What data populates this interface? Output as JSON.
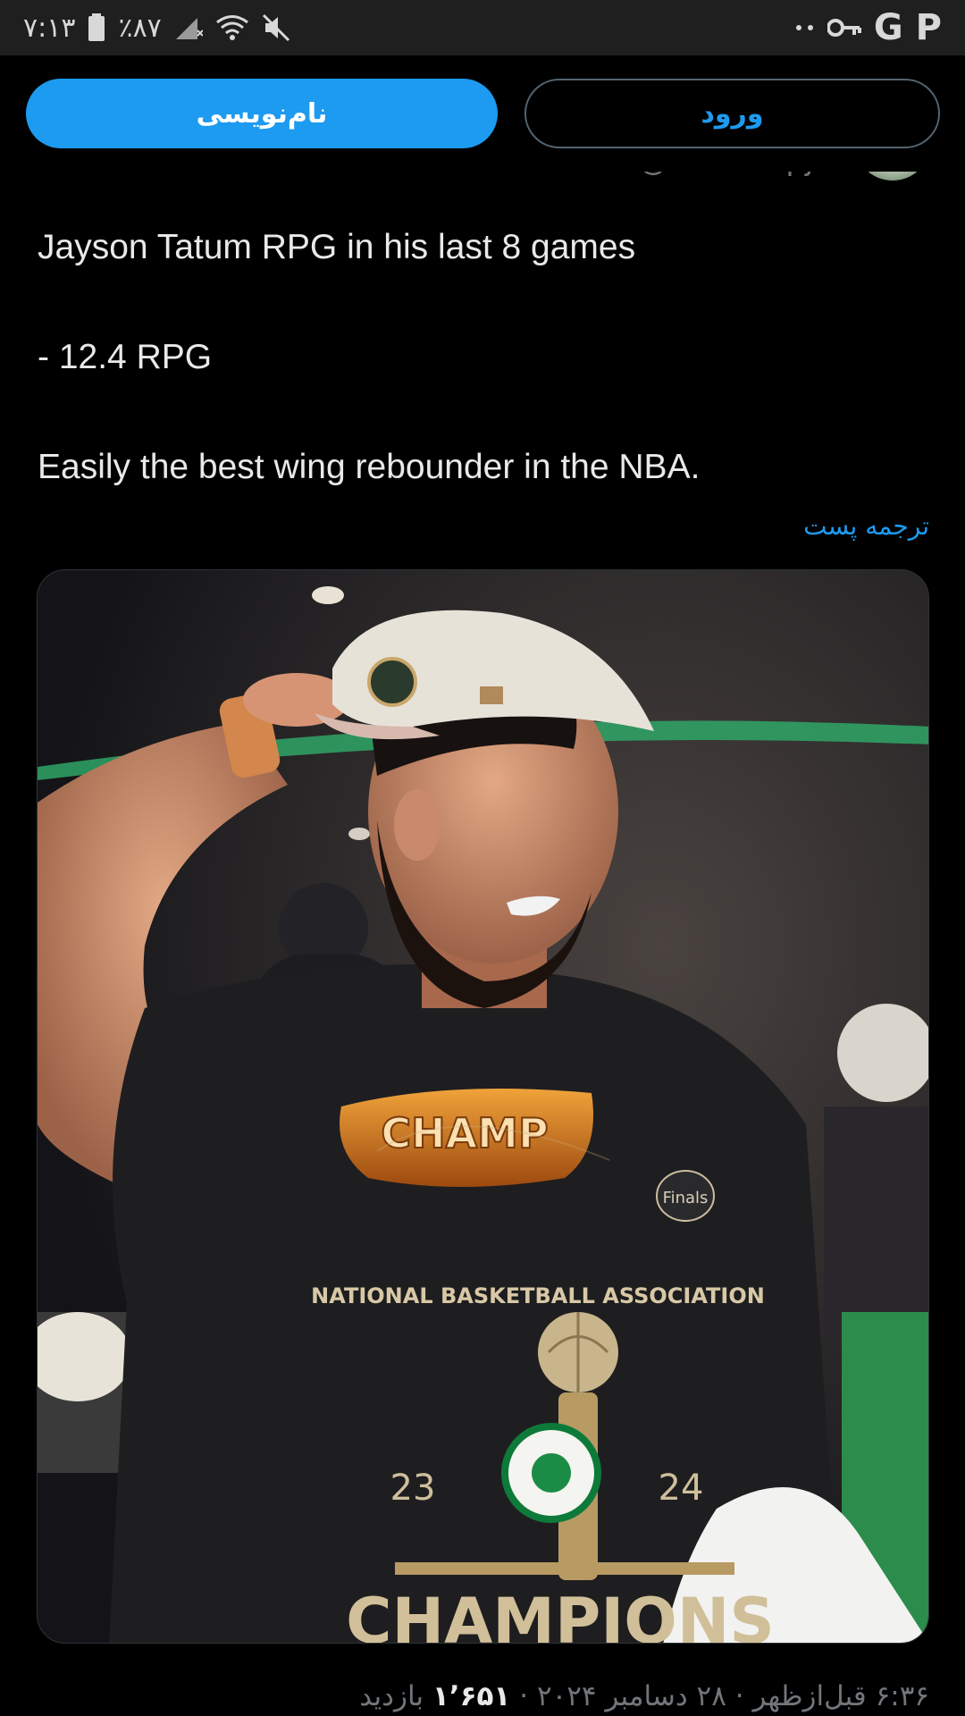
{
  "status_bar": {
    "time": "۷:۱۳",
    "battery": "٪۸۷",
    "icons_left": [
      "battery-icon",
      "signal-icon",
      "wifi-icon",
      "mute-icon"
    ],
    "icons_right": [
      "dots-icon",
      "key-icon",
      "google-icon",
      "p-app-icon"
    ],
    "google_letter": "G",
    "p_letter": "P"
  },
  "header": {
    "signup_label": "نام‌نویسی",
    "login_label": "ورود"
  },
  "author": {
    "handle": "@lockedupjb"
  },
  "tweet": {
    "line1": "Jayson Tatum RPG in his last 8 games",
    "line2": "- 12.4 RPG",
    "line3": "Easily the best wing rebounder in the NBA.",
    "translate_label": "ترجمه پست"
  },
  "media": {
    "goggles_text": "CHAMP",
    "shirt_text": "NATIONAL BASKETBALL ASSOCIATION",
    "bottom_text": "CHAMPIONS",
    "year_left": "23",
    "year_right": "24",
    "badge_text": "Finals"
  },
  "meta": {
    "time": "۶:۳۶ قبل‌ازظهر",
    "date": "۲۸ دسامبر ۲۰۲۴",
    "views_count": "۱٬۶۵۱",
    "views_label": "بازدید",
    "separator": "·"
  },
  "colors": {
    "accent": "#1d9bf0",
    "background": "#000000",
    "status_bar": "#1f1f1f",
    "text_primary": "#e7e9ea",
    "text_secondary": "#71767b"
  }
}
